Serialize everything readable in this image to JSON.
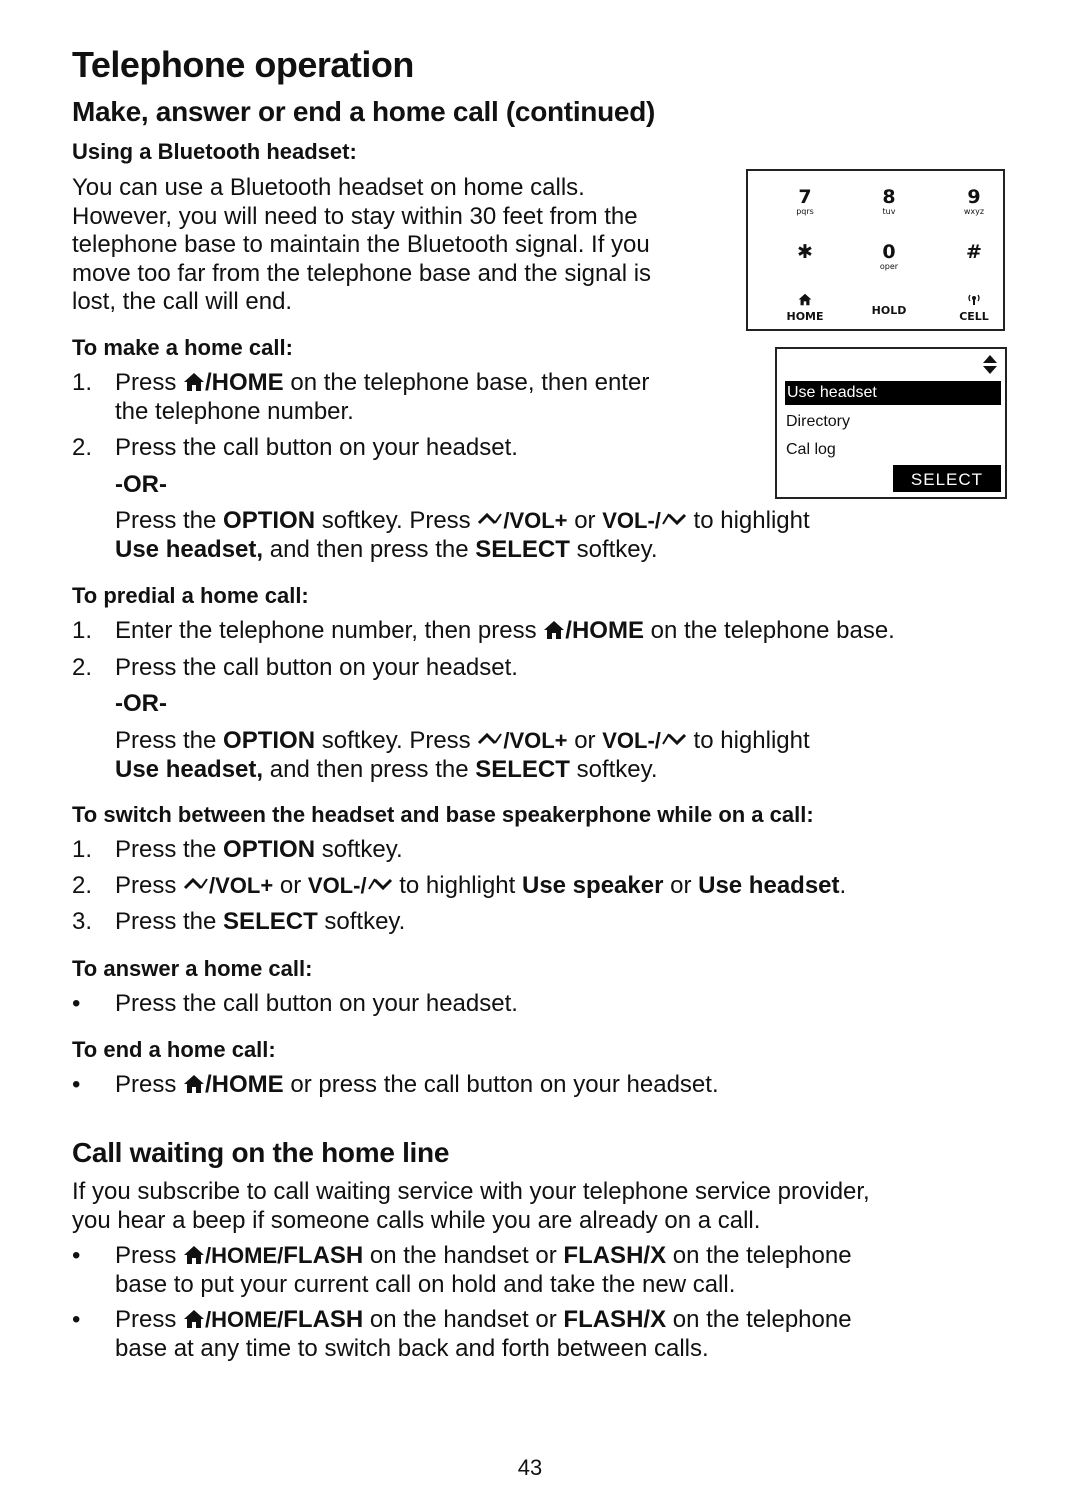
{
  "page": {
    "title": "Telephone operation",
    "section_title": "Make, answer or end a home call (continued)",
    "page_number": "43"
  },
  "bluetooth": {
    "heading": "Using a Bluetooth headset:",
    "lines": [
      "You can use a Bluetooth headset on home calls.",
      "However, you will need to stay within 30 feet from the",
      "telephone base to maintain the Bluetooth signal. If you",
      "move too far from the telephone base and the signal is",
      "lost, the call will end."
    ]
  },
  "keypad": {
    "keys": [
      {
        "digit": "7",
        "sub": "pqrs"
      },
      {
        "digit": "8",
        "sub": "tuv"
      },
      {
        "digit": "9",
        "sub": "wxyz"
      },
      {
        "digit": "✱",
        "sub": ""
      },
      {
        "digit": "0",
        "sub": "oper"
      },
      {
        "digit": "#",
        "sub": ""
      }
    ],
    "buttons": [
      "HOME",
      "HOLD",
      "CELL"
    ]
  },
  "screen": {
    "items": [
      "Use headset",
      "Directory",
      "Cal log"
    ],
    "selected_index": 0,
    "softkey": "SELECT"
  },
  "make_call": {
    "heading": "To make a home call:",
    "step1_num": "1.",
    "step1_a": "Press ",
    "step1_b": "/HOME",
    "step1_c": " on the telephone base, then enter",
    "step1_d": "the telephone number.",
    "step2_num": "2.",
    "step2": "Press the call button on your headset.",
    "or": "-OR-",
    "alt_a": "Press the ",
    "alt_b": "OPTION",
    "alt_c": " softkey. Press ",
    "alt_d": "/VOL+",
    "alt_e": " or ",
    "alt_f": "VOL-/",
    "alt_g": " to highlight",
    "alt2_a": "Use headset,",
    "alt2_b": " and then press the ",
    "alt2_c": "SELECT",
    "alt2_d": " softkey."
  },
  "predial": {
    "heading": "To predial a home call:",
    "step1_num": "1.",
    "step1_a": "Enter the telephone number, then press ",
    "step1_b": "/HOME",
    "step1_c": " on the telephone base.",
    "step2_num": "2.",
    "step2": "Press the call button on your headset.",
    "or": "-OR-"
  },
  "switch": {
    "heading": "To switch between the headset and base speakerphone while on a call:",
    "s1_num": "1.",
    "s1_a": "Press the ",
    "s1_b": "OPTION",
    "s1_c": " softkey.",
    "s2_num": "2.",
    "s2_a": "Press ",
    "s2_b": "/VOL+",
    "s2_c": " or ",
    "s2_d": "VOL-/",
    "s2_e": " to highlight ",
    "s2_f": "Use speaker",
    "s2_g": " or ",
    "s2_h": "Use headset",
    "s2_i": ".",
    "s3_num": "3.",
    "s3_a": "Press the ",
    "s3_b": "SELECT",
    "s3_c": " softkey."
  },
  "answer": {
    "heading": "To answer a home call:",
    "bullet": "•",
    "text": "Press the call button on your headset."
  },
  "end": {
    "heading": "To end a home call:",
    "bullet": "•",
    "a": "Press ",
    "b": "/HOME",
    "c": " or press the call button on your headset."
  },
  "call_waiting": {
    "title": "Call waiting on the home line",
    "intro1": "If you subscribe to call waiting service with your telephone service provider,",
    "intro2": "you hear a beep if someone calls while you are already on a call.",
    "bullet": "•",
    "b_a": "Press ",
    "b_b": "/HOME/",
    "b_c": "FLASH",
    "b_d": " on the handset or ",
    "b_e": "FLASH/X",
    "b_f": " on the telephone",
    "b1_line2": "base to put your current call on hold and take the new call.",
    "b2_line2": "base at any time to switch back and forth between calls."
  }
}
